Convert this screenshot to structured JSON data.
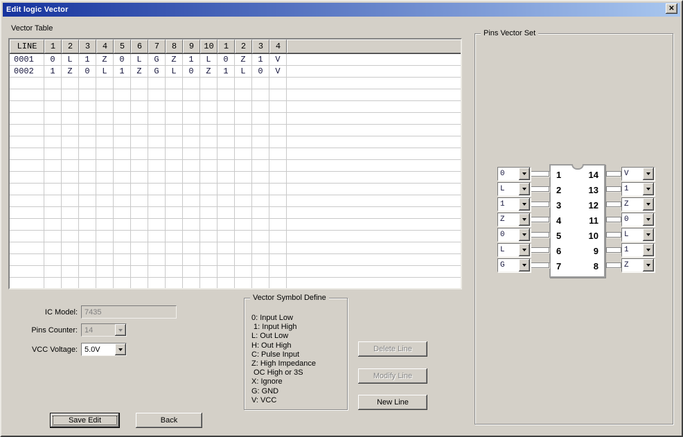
{
  "window": {
    "title": "Edit logic Vector",
    "close_glyph": "✕"
  },
  "colors": {
    "titlebar_start": "#16339e",
    "titlebar_end": "#a9c7ef",
    "dialog_bg": "#d4d0c8",
    "grid_line": "#c9c9c9"
  },
  "vector_table": {
    "label": "Vector Table",
    "columns": [
      "LINE",
      "1",
      "2",
      "3",
      "4",
      "5",
      "6",
      "7",
      "8",
      "9",
      "10",
      "1",
      "2",
      "3",
      "4"
    ],
    "rows": [
      {
        "line": "0001",
        "values": [
          "0",
          "L",
          "1",
          "Z",
          "0",
          "L",
          "G",
          "Z",
          "1",
          "L",
          "0",
          "Z",
          "1",
          "V"
        ]
      },
      {
        "line": "0002",
        "values": [
          "1",
          "Z",
          "0",
          "L",
          "1",
          "Z",
          "G",
          "L",
          "0",
          "Z",
          "1",
          "L",
          "0",
          "V"
        ]
      }
    ],
    "empty_row_count": 18
  },
  "pins_vector_set": {
    "label": "Pins Vector Set",
    "left_pins": [
      {
        "pin": "1",
        "value": "0"
      },
      {
        "pin": "2",
        "value": "L"
      },
      {
        "pin": "3",
        "value": "1"
      },
      {
        "pin": "4",
        "value": "Z"
      },
      {
        "pin": "5",
        "value": "0"
      },
      {
        "pin": "6",
        "value": "L"
      },
      {
        "pin": "7",
        "value": "G"
      }
    ],
    "right_pins": [
      {
        "pin": "14",
        "value": "V"
      },
      {
        "pin": "13",
        "value": "1"
      },
      {
        "pin": "12",
        "value": "Z"
      },
      {
        "pin": "11",
        "value": "0"
      },
      {
        "pin": "10",
        "value": "L"
      },
      {
        "pin": "9",
        "value": "1"
      },
      {
        "pin": "8",
        "value": "Z"
      }
    ]
  },
  "form": {
    "ic_model_label": "IC Model:",
    "ic_model_value": "7435",
    "pins_counter_label": "Pins Counter:",
    "pins_counter_value": "14",
    "vcc_voltage_label": "VCC Voltage:",
    "vcc_voltage_value": "5.0V"
  },
  "symbol_define": {
    "label": "Vector Symbol Define",
    "lines": [
      "0: Input Low",
      " 1: Input High",
      "L: Out Low",
      "H: Out High",
      "C: Pulse Input",
      "Z: High Impedance",
      " OC High or 3S",
      "X: Ignore",
      "G: GND",
      "V: VCC"
    ]
  },
  "buttons": {
    "delete_line": "Delete Line",
    "modify_line": "Modify Line",
    "new_line": "New Line",
    "save_edit": "Save Edit",
    "back": "Back"
  }
}
